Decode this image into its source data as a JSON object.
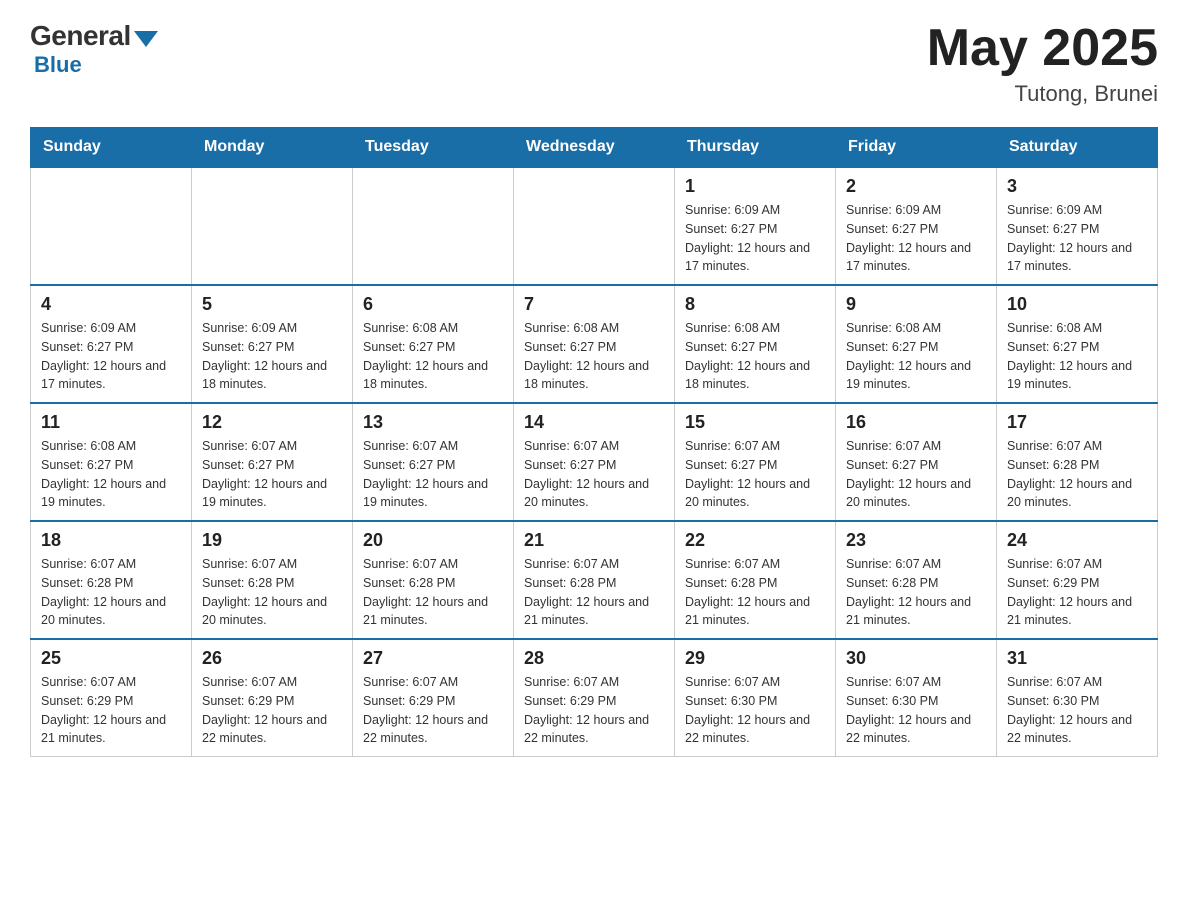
{
  "header": {
    "logo": {
      "general": "General",
      "blue": "Blue"
    },
    "title": "May 2025",
    "location": "Tutong, Brunei"
  },
  "weekdays": [
    "Sunday",
    "Monday",
    "Tuesday",
    "Wednesday",
    "Thursday",
    "Friday",
    "Saturday"
  ],
  "weeks": [
    [
      {
        "day": "",
        "info": ""
      },
      {
        "day": "",
        "info": ""
      },
      {
        "day": "",
        "info": ""
      },
      {
        "day": "",
        "info": ""
      },
      {
        "day": "1",
        "info": "Sunrise: 6:09 AM\nSunset: 6:27 PM\nDaylight: 12 hours and 17 minutes."
      },
      {
        "day": "2",
        "info": "Sunrise: 6:09 AM\nSunset: 6:27 PM\nDaylight: 12 hours and 17 minutes."
      },
      {
        "day": "3",
        "info": "Sunrise: 6:09 AM\nSunset: 6:27 PM\nDaylight: 12 hours and 17 minutes."
      }
    ],
    [
      {
        "day": "4",
        "info": "Sunrise: 6:09 AM\nSunset: 6:27 PM\nDaylight: 12 hours and 17 minutes."
      },
      {
        "day": "5",
        "info": "Sunrise: 6:09 AM\nSunset: 6:27 PM\nDaylight: 12 hours and 18 minutes."
      },
      {
        "day": "6",
        "info": "Sunrise: 6:08 AM\nSunset: 6:27 PM\nDaylight: 12 hours and 18 minutes."
      },
      {
        "day": "7",
        "info": "Sunrise: 6:08 AM\nSunset: 6:27 PM\nDaylight: 12 hours and 18 minutes."
      },
      {
        "day": "8",
        "info": "Sunrise: 6:08 AM\nSunset: 6:27 PM\nDaylight: 12 hours and 18 minutes."
      },
      {
        "day": "9",
        "info": "Sunrise: 6:08 AM\nSunset: 6:27 PM\nDaylight: 12 hours and 19 minutes."
      },
      {
        "day": "10",
        "info": "Sunrise: 6:08 AM\nSunset: 6:27 PM\nDaylight: 12 hours and 19 minutes."
      }
    ],
    [
      {
        "day": "11",
        "info": "Sunrise: 6:08 AM\nSunset: 6:27 PM\nDaylight: 12 hours and 19 minutes."
      },
      {
        "day": "12",
        "info": "Sunrise: 6:07 AM\nSunset: 6:27 PM\nDaylight: 12 hours and 19 minutes."
      },
      {
        "day": "13",
        "info": "Sunrise: 6:07 AM\nSunset: 6:27 PM\nDaylight: 12 hours and 19 minutes."
      },
      {
        "day": "14",
        "info": "Sunrise: 6:07 AM\nSunset: 6:27 PM\nDaylight: 12 hours and 20 minutes."
      },
      {
        "day": "15",
        "info": "Sunrise: 6:07 AM\nSunset: 6:27 PM\nDaylight: 12 hours and 20 minutes."
      },
      {
        "day": "16",
        "info": "Sunrise: 6:07 AM\nSunset: 6:27 PM\nDaylight: 12 hours and 20 minutes."
      },
      {
        "day": "17",
        "info": "Sunrise: 6:07 AM\nSunset: 6:28 PM\nDaylight: 12 hours and 20 minutes."
      }
    ],
    [
      {
        "day": "18",
        "info": "Sunrise: 6:07 AM\nSunset: 6:28 PM\nDaylight: 12 hours and 20 minutes."
      },
      {
        "day": "19",
        "info": "Sunrise: 6:07 AM\nSunset: 6:28 PM\nDaylight: 12 hours and 20 minutes."
      },
      {
        "day": "20",
        "info": "Sunrise: 6:07 AM\nSunset: 6:28 PM\nDaylight: 12 hours and 21 minutes."
      },
      {
        "day": "21",
        "info": "Sunrise: 6:07 AM\nSunset: 6:28 PM\nDaylight: 12 hours and 21 minutes."
      },
      {
        "day": "22",
        "info": "Sunrise: 6:07 AM\nSunset: 6:28 PM\nDaylight: 12 hours and 21 minutes."
      },
      {
        "day": "23",
        "info": "Sunrise: 6:07 AM\nSunset: 6:28 PM\nDaylight: 12 hours and 21 minutes."
      },
      {
        "day": "24",
        "info": "Sunrise: 6:07 AM\nSunset: 6:29 PM\nDaylight: 12 hours and 21 minutes."
      }
    ],
    [
      {
        "day": "25",
        "info": "Sunrise: 6:07 AM\nSunset: 6:29 PM\nDaylight: 12 hours and 21 minutes."
      },
      {
        "day": "26",
        "info": "Sunrise: 6:07 AM\nSunset: 6:29 PM\nDaylight: 12 hours and 22 minutes."
      },
      {
        "day": "27",
        "info": "Sunrise: 6:07 AM\nSunset: 6:29 PM\nDaylight: 12 hours and 22 minutes."
      },
      {
        "day": "28",
        "info": "Sunrise: 6:07 AM\nSunset: 6:29 PM\nDaylight: 12 hours and 22 minutes."
      },
      {
        "day": "29",
        "info": "Sunrise: 6:07 AM\nSunset: 6:30 PM\nDaylight: 12 hours and 22 minutes."
      },
      {
        "day": "30",
        "info": "Sunrise: 6:07 AM\nSunset: 6:30 PM\nDaylight: 12 hours and 22 minutes."
      },
      {
        "day": "31",
        "info": "Sunrise: 6:07 AM\nSunset: 6:30 PM\nDaylight: 12 hours and 22 minutes."
      }
    ]
  ]
}
